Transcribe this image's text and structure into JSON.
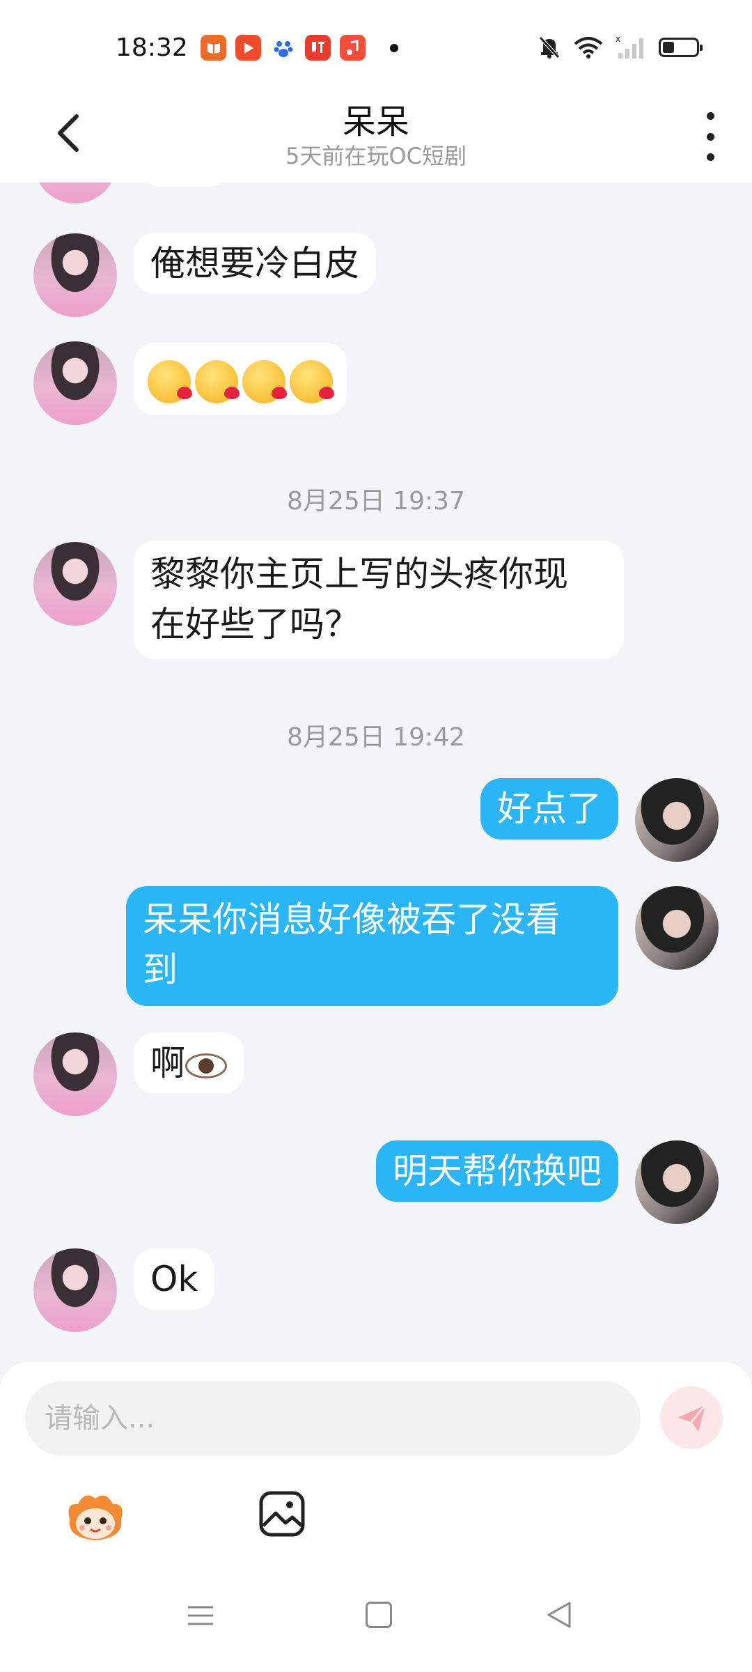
{
  "status_bar": {
    "time": "18:32",
    "app_icons": [
      {
        "icon": "book-app-icon",
        "color": "#f06a2a"
      },
      {
        "icon": "video-app-icon",
        "color": "#f04b2a"
      },
      {
        "icon": "baidu-paw-icon",
        "color": "#2d6ee8"
      },
      {
        "icon": "listen-app-icon",
        "color": "#e83d2c"
      },
      {
        "icon": "music-app-icon",
        "color": "#f44d3a"
      }
    ],
    "indicators": [
      "mute-bell-icon",
      "wifi-icon",
      "signal-bars-icon",
      "battery-icon"
    ],
    "battery_level": 0.35
  },
  "header": {
    "title": "呆呆",
    "subtitle": "5天前在玩OC短剧"
  },
  "messages": {
    "m1": "俺想要冷白皮",
    "m2_emoji": "kissing-face-emoji",
    "m2_count": 4,
    "ts1": "8月25日 19:37",
    "m3_line1": "黎黎你主页上写的头疼你现",
    "m3_line2": "在好些了吗？",
    "ts2": "8月25日 19:42",
    "m4": "好点了",
    "m5_line1": "呆呆你消息好像被吞了没看",
    "m5_line2": "到",
    "m6": "啊",
    "m6_emoji": "eye-emoji",
    "m7": "明天帮你换吧",
    "m8": "Ok"
  },
  "input": {
    "placeholder": "请输入..."
  },
  "colors": {
    "self_bubble": "#2ab5f7",
    "other_bubble": "#ffffff",
    "chat_background": "#f2f4f7",
    "send_button_bg": "#fde7e9",
    "send_button_icon": "#f7a7ae"
  }
}
